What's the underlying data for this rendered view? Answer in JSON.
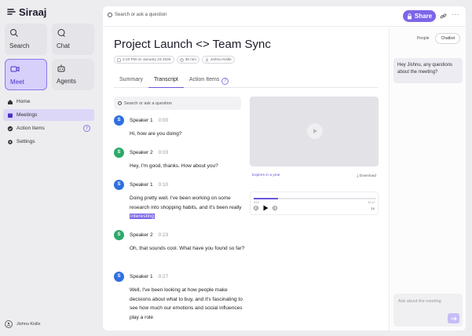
{
  "app": {
    "name": "Siraaj"
  },
  "sidebar": {
    "tiles": [
      {
        "label": "Search",
        "icon": "search-icon"
      },
      {
        "label": "Chat",
        "icon": "chat-icon"
      },
      {
        "label": "Meet",
        "icon": "video-icon",
        "active": true
      },
      {
        "label": "Agents",
        "icon": "robot-icon"
      }
    ],
    "nav": [
      {
        "label": "Home",
        "icon": "home-icon"
      },
      {
        "label": "Meetings",
        "icon": "calendar-icon",
        "active": true
      },
      {
        "label": "Action Items",
        "icon": "check-icon",
        "badge": "7"
      },
      {
        "label": "Settings",
        "icon": "gear-icon"
      }
    ],
    "user": {
      "name": "Jishnu Kislle"
    }
  },
  "topbar": {
    "search_placeholder": "Search or ask a question",
    "share_label": "Share"
  },
  "meeting": {
    "title": "Project Launch <> Team Sync",
    "meta": {
      "datetime": "2:10 PM on January 23 2025",
      "duration": "35 min",
      "owner": "Jishnu Kislle"
    },
    "tabs": [
      {
        "label": "Summary"
      },
      {
        "label": "Transcript",
        "active": true
      },
      {
        "label": "Action Items",
        "badge": "7"
      }
    ],
    "transcript_search_placeholder": "Search or ask a question",
    "transcript": [
      {
        "initial": "S",
        "speaker": "Speaker 1",
        "time": "0:00",
        "color": "#2f6fe0",
        "text": "Hi, how are you doing?"
      },
      {
        "initial": "S",
        "speaker": "Speaker 2",
        "time": "0:03",
        "color": "#2ea86a",
        "text": "Hey, I'm good, thanks. How about you?"
      },
      {
        "initial": "S",
        "speaker": "Speaker 1",
        "time": "0:10",
        "color": "#2f6fe0",
        "text": "Doing pretty well. I've been working on some research into shopping habits, and it's been really",
        "highlight": "interesting"
      },
      {
        "initial": "S",
        "speaker": "Speaker 2",
        "time": "0:23",
        "color": "#2ea86a",
        "text": "Oh, that sounds cool. What have you found so far?"
      },
      {
        "initial": "S",
        "speaker": "Speaker 1",
        "time": "0:27",
        "color": "#2f6fe0",
        "text": "Well, I've been looking at how people make decisions about what to buy, and it's fascinating to see how much our emotions and social influences play a role"
      }
    ],
    "video": {
      "expires": "Expires in a year",
      "download": "Download",
      "player": {
        "current": "0:10",
        "total": "34:12",
        "speed": "1x",
        "progress": 0.2
      }
    }
  },
  "chat": {
    "modes": [
      {
        "label": "People"
      },
      {
        "label": "Chatbot",
        "active": true
      }
    ],
    "message": "Hey Jishnu, any questions about the meeting?",
    "input_placeholder": "Ask about the meeting"
  },
  "colors": {
    "accent": "#7d65e8",
    "accent_light": "#d7d0fb",
    "speaker1": "#2f6fe0",
    "speaker2": "#2ea86a"
  }
}
